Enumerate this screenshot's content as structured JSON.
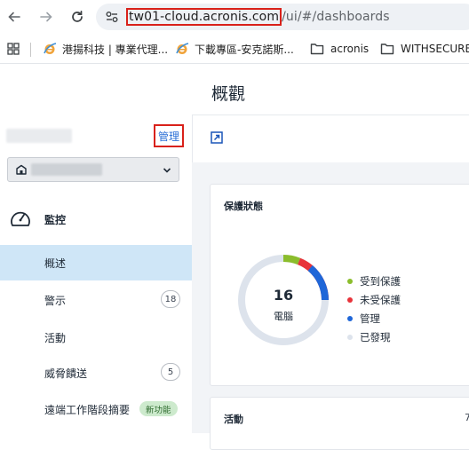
{
  "browser": {
    "url_host": "tw01-cloud.acronis.com",
    "url_path": "/ui/#/dashboards",
    "bookmarks": [
      {
        "label": "港揚科技 | 專業代理..."
      },
      {
        "label": "下載專區-安克諾斯..."
      },
      {
        "label": "acronis"
      },
      {
        "label": "WITHSECURE"
      }
    ]
  },
  "sidebar": {
    "manage_label": "管理",
    "section_label": "監控",
    "items": [
      {
        "label": "概述"
      },
      {
        "label": "警示",
        "count": "18"
      },
      {
        "label": "活動"
      },
      {
        "label": "威脅饋送",
        "count": "5"
      },
      {
        "label": "遠端工作階段摘要",
        "badge": "新功能"
      }
    ]
  },
  "main": {
    "page_title": "概觀",
    "protection_card": {
      "title": "保護狀態",
      "total": "16",
      "total_label": "電腦",
      "legend": [
        {
          "label": "受到保護",
          "color": "#8bbd2c"
        },
        {
          "label": "未受保護",
          "color": "#e8333a"
        },
        {
          "label": "管理",
          "color": "#1f66d8"
        },
        {
          "label": "已發現",
          "color": "#dde3ec"
        }
      ]
    },
    "activity_card": {
      "title": "活動",
      "trailing": "7"
    }
  }
}
